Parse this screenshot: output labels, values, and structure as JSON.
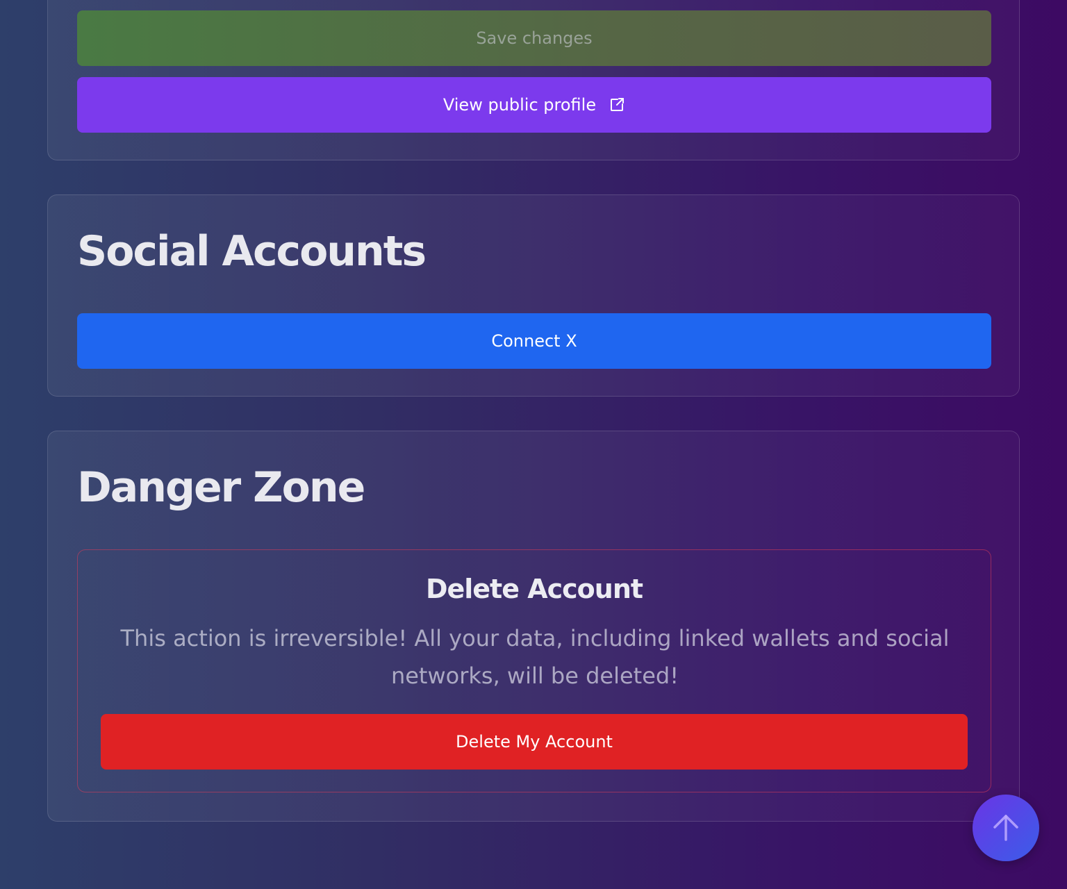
{
  "profile": {
    "save_label": "Save changes",
    "view_profile_label": "View public profile",
    "view_profile_icon": "external-link-icon"
  },
  "social": {
    "title": "Social Accounts",
    "connect_x_label": "Connect X"
  },
  "danger": {
    "title": "Danger Zone",
    "delete_title": "Delete Account",
    "delete_warning": "This action is irreversible! All your data, including linked wallets and social networks, will be deleted!",
    "delete_button_label": "Delete My Account"
  },
  "scroll_top": {
    "icon": "arrow-up-icon"
  },
  "colors": {
    "primary_purple": "#7c3aed",
    "connect_blue": "#1f66f0",
    "danger_red": "#e02224"
  }
}
